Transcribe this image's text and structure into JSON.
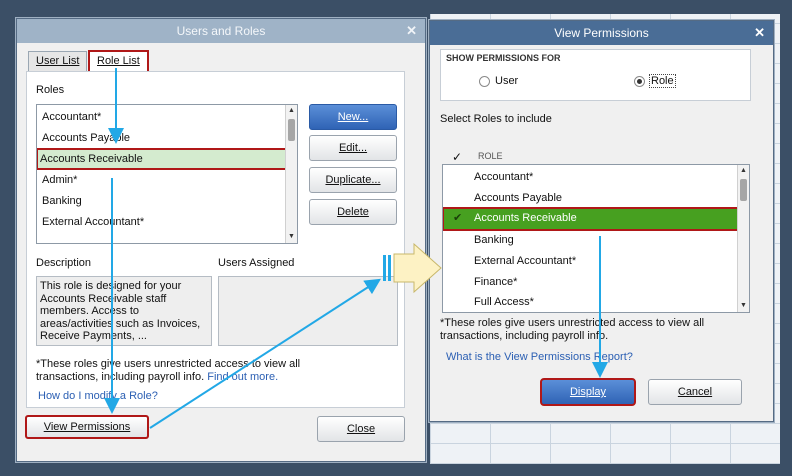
{
  "users_roles": {
    "title": "Users and Roles",
    "tabs": [
      "User List",
      "Role List"
    ],
    "roles_label": "Roles",
    "roles": [
      "Accountant*",
      "Accounts Payable",
      "Accounts Receivable",
      "Admin*",
      "Banking",
      "External Accountant*"
    ],
    "selected_role": "Accounts Receivable",
    "buttons": {
      "new": "New...",
      "edit": "Edit...",
      "duplicate": "Duplicate...",
      "delete": "Delete"
    },
    "description_label": "Description",
    "users_assigned_label": "Users Assigned",
    "description_text": "This role is designed for your Accounts Receivable staff members. Access to areas/activities such as Invoices, Receive Payments, ...",
    "note": "*These roles give users unrestricted access to view all transactions, including payroll info.",
    "find_out_more": "Find out more.",
    "modify_link": "How do I modify a Role?",
    "view_permissions": "View Permissions",
    "close": "Close"
  },
  "view_permissions": {
    "title": "View Permissions",
    "show_for_label": "SHOW PERMISSIONS FOR",
    "user_option": "User",
    "role_option": "Role",
    "selected_option": "Role",
    "select_roles_label": "Select Roles to include",
    "check_header": "✓",
    "role_header": "ROLE",
    "roles": [
      "Accountant*",
      "Accounts Payable",
      "Accounts Receivable",
      "Banking",
      "External Accountant*",
      "Finance*",
      "Full Access*"
    ],
    "checked_role": "Accounts Receivable",
    "note": "*These roles give users unrestricted access to view all transactions, including payroll info.",
    "report_link": "What is the View Permissions Report?",
    "display": "Display",
    "cancel": "Cancel"
  },
  "colors": {
    "highlight_red": "#b01818",
    "selected_green": "#47a020",
    "selected_light": "#d4ebcf",
    "arrow_blue": "#22a8e6",
    "title_active": "#4a6d96"
  },
  "icons": [
    "close-icon",
    "scroll-up-arrow-icon",
    "scroll-down-arrow-icon",
    "checkmark-icon",
    "transfer-arrow-icon"
  ]
}
